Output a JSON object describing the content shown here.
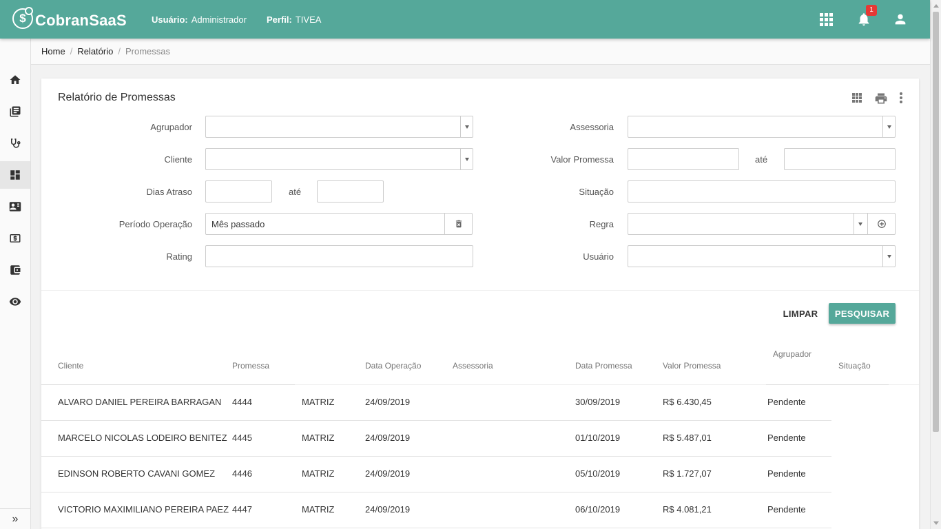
{
  "header": {
    "logo_text": "CobranSaaS",
    "user_label": "Usuário:",
    "user_value": "Administrador",
    "perfil_label": "Perfil:",
    "perfil_value": "TIVEA",
    "notifications_count": "1"
  },
  "sidebar": {
    "items": [
      "home-icon",
      "book-icon",
      "stethoscope-icon",
      "dashboard-icon",
      "contact-card-icon",
      "money-icon",
      "wallet-icon",
      "eye-icon"
    ],
    "active_index": 3,
    "expand_symbol": "»"
  },
  "breadcrumb": {
    "items": [
      "Home",
      "Relatório",
      "Promessas"
    ]
  },
  "page": {
    "title": "Relatório de Promessas"
  },
  "filters": {
    "agrupador_label": "Agrupador",
    "cliente_label": "Cliente",
    "dias_atraso_label": "Dias Atraso",
    "ate_label": "até",
    "periodo_label": "Período Operação",
    "periodo_value": "Mês passado",
    "rating_label": "Rating",
    "assessoria_label": "Assessoria",
    "valor_promessa_label": "Valor Promessa",
    "situacao_label": "Situação",
    "regra_label": "Regra",
    "usuario_label": "Usuário"
  },
  "actions": {
    "limpar": "LIMPAR",
    "pesquisar": "PESQUISAR"
  },
  "table": {
    "headers": {
      "cliente": "Cliente",
      "promessa": "Promessa",
      "data_operacao": "Data Operação",
      "assessoria": "Assessoria",
      "data_promessa": "Data Promessa",
      "valor_promessa": "Valor Promessa",
      "agrupador": "Agrupador",
      "situacao": "Situação"
    },
    "rows": [
      {
        "cliente": "ALVARO DANIEL PEREIRA BARRAGAN",
        "promessa": "4444",
        "filial": "MATRIZ",
        "data_operacao": "24/09/2019",
        "data_promessa": "30/09/2019",
        "valor": "R$ 6.430,45",
        "situacao": "Pendente"
      },
      {
        "cliente": "MARCELO NICOLAS LODEIRO BENITEZ",
        "promessa": "4445",
        "filial": "MATRIZ",
        "data_operacao": "24/09/2019",
        "data_promessa": "01/10/2019",
        "valor": "R$ 5.487,01",
        "situacao": "Pendente"
      },
      {
        "cliente": "EDINSON ROBERTO CAVANI GOMEZ",
        "promessa": "4446",
        "filial": "MATRIZ",
        "data_operacao": "24/09/2019",
        "data_promessa": "05/10/2019",
        "valor": "R$ 1.727,07",
        "situacao": "Pendente"
      },
      {
        "cliente": "VICTORIO MAXIMILIANO PEREIRA PAEZ",
        "promessa": "4447",
        "filial": "MATRIZ",
        "data_operacao": "24/09/2019",
        "data_promessa": "06/10/2019",
        "valor": "R$ 4.081,21",
        "situacao": "Pendente"
      }
    ]
  },
  "colors": {
    "primary": "#55a89a",
    "badge": "#e53935"
  }
}
